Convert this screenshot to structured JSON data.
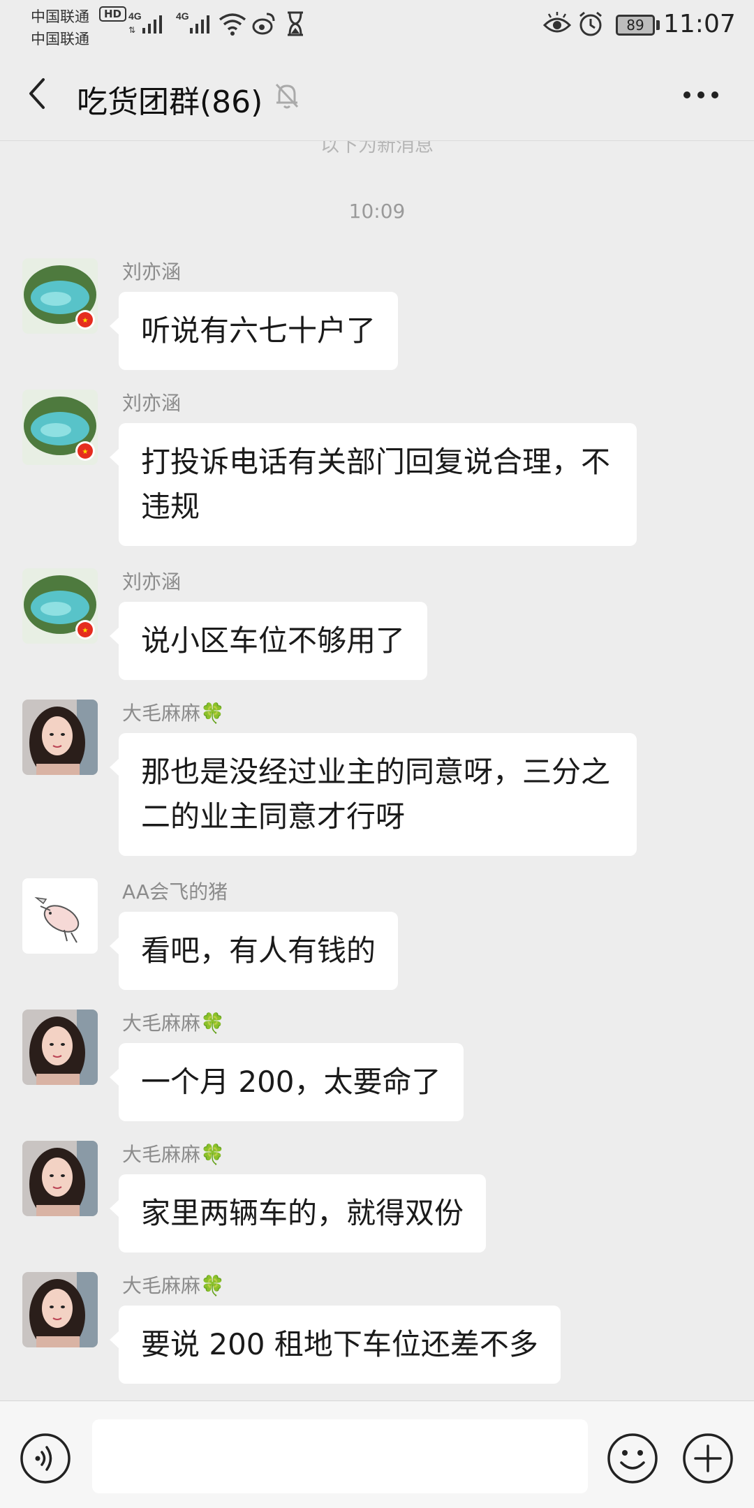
{
  "status_bar": {
    "carrier_1": "中国联通",
    "carrier_2": "中国联通",
    "hd_badge": "HD",
    "signal_1_label": "4G",
    "signal_2_label": "4G",
    "battery_level": "89",
    "time": "11:07",
    "icons": [
      "signal-icon",
      "wifi-icon",
      "weibo-icon",
      "hourglass-icon",
      "eye-icon",
      "alarm-icon",
      "battery-icon"
    ]
  },
  "header": {
    "title": "吃货团群(86)",
    "icons": [
      "back-icon",
      "mute-bell-icon",
      "more-icon"
    ]
  },
  "divider_text": "以下为新消息",
  "time_label": "10:09",
  "messages": [
    {
      "sender": "刘亦涵",
      "text": "听说有六七十户了",
      "avatar": "landscape-avatar"
    },
    {
      "sender": "刘亦涵",
      "text": "打投诉电话有关部门回复说合理，不违规",
      "avatar": "landscape-avatar"
    },
    {
      "sender": "刘亦涵",
      "text": "说小区车位不够用了",
      "avatar": "landscape-avatar"
    },
    {
      "sender": "大毛麻麻🍀",
      "text": "那也是没经过业主的同意呀，三分之二的业主同意才行呀",
      "avatar": "woman-avatar"
    },
    {
      "sender": "AA会飞的猪",
      "text": "看吧，有人有钱的",
      "avatar": "flying-pig-avatar"
    },
    {
      "sender": "大毛麻麻🍀",
      "text": "一个月 200，太要命了",
      "avatar": "woman-avatar"
    },
    {
      "sender": "大毛麻麻🍀",
      "text": "家里两辆车的，就得双份",
      "avatar": "woman-avatar"
    },
    {
      "sender": "大毛麻麻🍀",
      "text": "要说 200 租地下车位还差不多",
      "avatar": "woman-avatar"
    }
  ],
  "input_bar": {
    "input_value": "",
    "icons": [
      "voice-icon",
      "emoji-icon",
      "plus-icon"
    ]
  },
  "colors": {
    "background": "#ededed",
    "bubble": "#ffffff",
    "sender_name": "#8c8c8c",
    "time_label": "#9a9a9a"
  }
}
